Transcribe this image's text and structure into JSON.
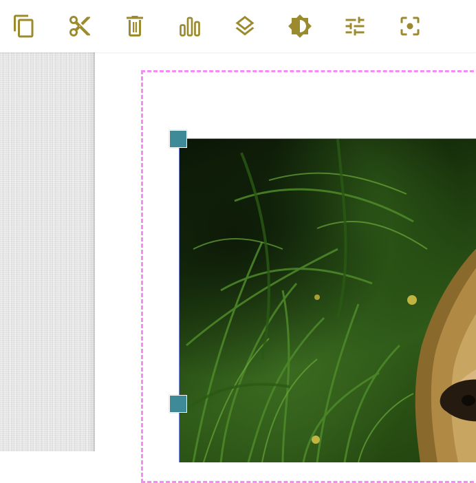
{
  "toolbar": {
    "accent_color": "#9c8a2e",
    "buttons": [
      {
        "name": "copy-button",
        "icon": "copy-icon"
      },
      {
        "name": "cut-button",
        "icon": "scissors-icon"
      },
      {
        "name": "delete-button",
        "icon": "trash-icon"
      },
      {
        "name": "chart-button",
        "icon": "bar-chart-icon"
      },
      {
        "name": "layers-button",
        "icon": "layers-icon"
      },
      {
        "name": "brightness-button",
        "icon": "brightness-icon"
      },
      {
        "name": "adjust-button",
        "icon": "sliders-icon"
      },
      {
        "name": "focus-button",
        "icon": "focus-icon"
      }
    ]
  },
  "canvas": {
    "selection_color": "#f58cf5",
    "handle_color": "#3f8a98",
    "image": {
      "subject": "lion-photo"
    }
  }
}
